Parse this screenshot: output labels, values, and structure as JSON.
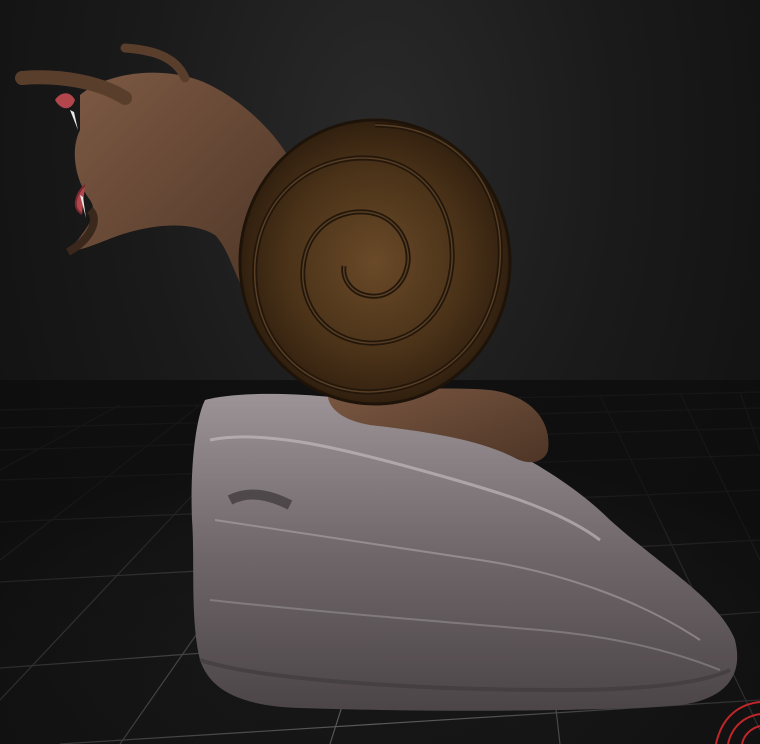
{
  "viewport": {
    "background_color": "#141414",
    "grid_color": "#9a9a9a"
  },
  "model": {
    "body_color": "#6b4a35",
    "shell_color": "#4a3218",
    "rock_color": "#7a7275",
    "mouth_color": "#b3454c"
  },
  "gizmo": {
    "icon": "rotation-gizmo-icon",
    "color": "#c0262a"
  }
}
